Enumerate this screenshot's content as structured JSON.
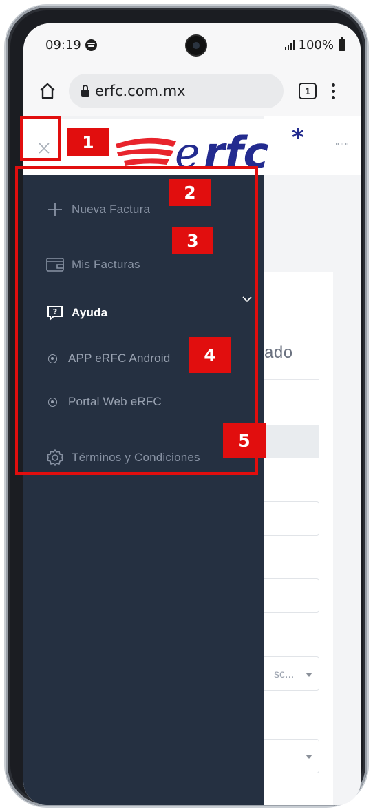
{
  "status_bar": {
    "time": "09:19",
    "battery": "100%"
  },
  "browser": {
    "url": "erfc.com.mx",
    "tab_count": "1"
  },
  "site": {
    "logo_text": "erfc",
    "logo_mark": "*"
  },
  "nav": {
    "items": [
      {
        "label": "Nueva Factura",
        "icon": "plus-icon"
      },
      {
        "label": "Mis Facturas",
        "icon": "wallet-icon"
      },
      {
        "label": "Ayuda",
        "icon": "help-icon"
      },
      {
        "label": "Términos y Condiciones",
        "icon": "gear-icon"
      }
    ],
    "help_sub_items": [
      "APP eRFC Android",
      "Portal Web eRFC"
    ]
  },
  "content": {
    "heading_fragment": "ado",
    "select_fragment": "sc..."
  },
  "annotations": [
    "1",
    "2",
    "3",
    "4",
    "5"
  ],
  "colors": {
    "drawer_bg": "#253041",
    "annotation_red": "#e10e0e",
    "logo_red": "#e8242c",
    "logo_blue": "#232b8f"
  }
}
